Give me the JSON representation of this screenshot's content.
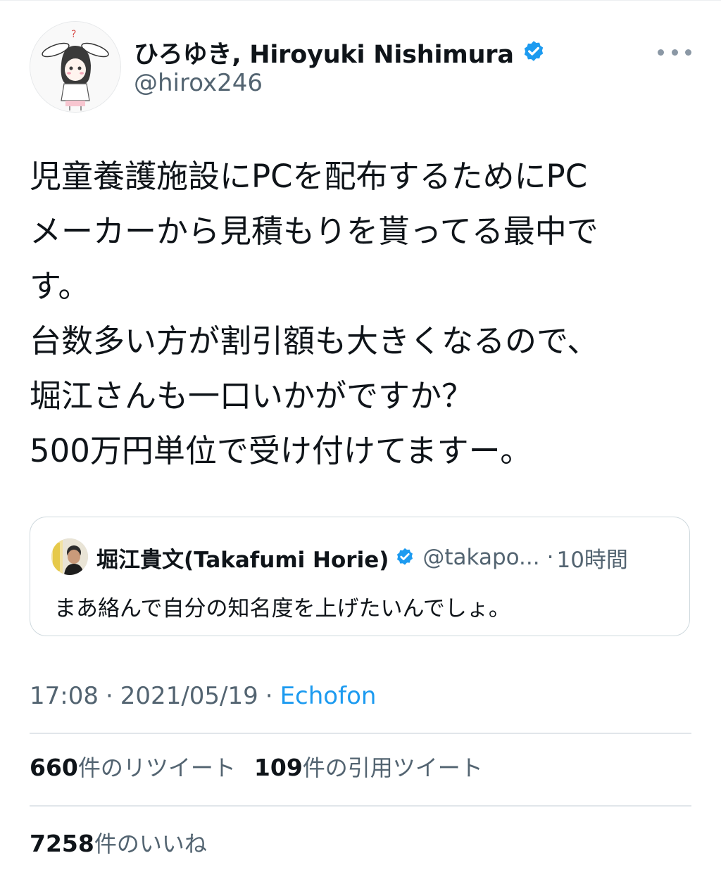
{
  "author": {
    "display_name": "ひろゆき, Hiroyuki Nishimura",
    "handle": "@hirox246",
    "verified": true,
    "avatar_icon": "bunny-ear-character-avatar"
  },
  "tweet": {
    "lines": [
      "児童養護施設にPCを配布するためにPC",
      "メーカーから見積もりを貰ってる最中で",
      "す。",
      "台数多い方が割引額も大きくなるので、",
      "堀江さんも一口いかがですか？",
      "500万円単位で受け付けてますー。"
    ]
  },
  "quote": {
    "display_name": "堀江貴文(Takafumi Horie)",
    "handle": "@takapo...",
    "separator": "·",
    "time": "10時間",
    "text": "まあ絡んで自分の知名度を上げたいんでしょ。",
    "verified": true
  },
  "meta": {
    "time": "17:08",
    "dot": "·",
    "date": "2021/05/19",
    "client": "Echofon"
  },
  "stats": {
    "retweets": {
      "count": "660",
      "label": "件のリツイート"
    },
    "quotes": {
      "count": "109",
      "label": "件の引用ツイート"
    },
    "likes": {
      "count": "7258",
      "label": "件のいいね"
    }
  },
  "colors": {
    "verified": "#1d9bf0",
    "secondary_text": "#536471",
    "link": "#1d9bf0",
    "divider": "#e1e6ea"
  }
}
